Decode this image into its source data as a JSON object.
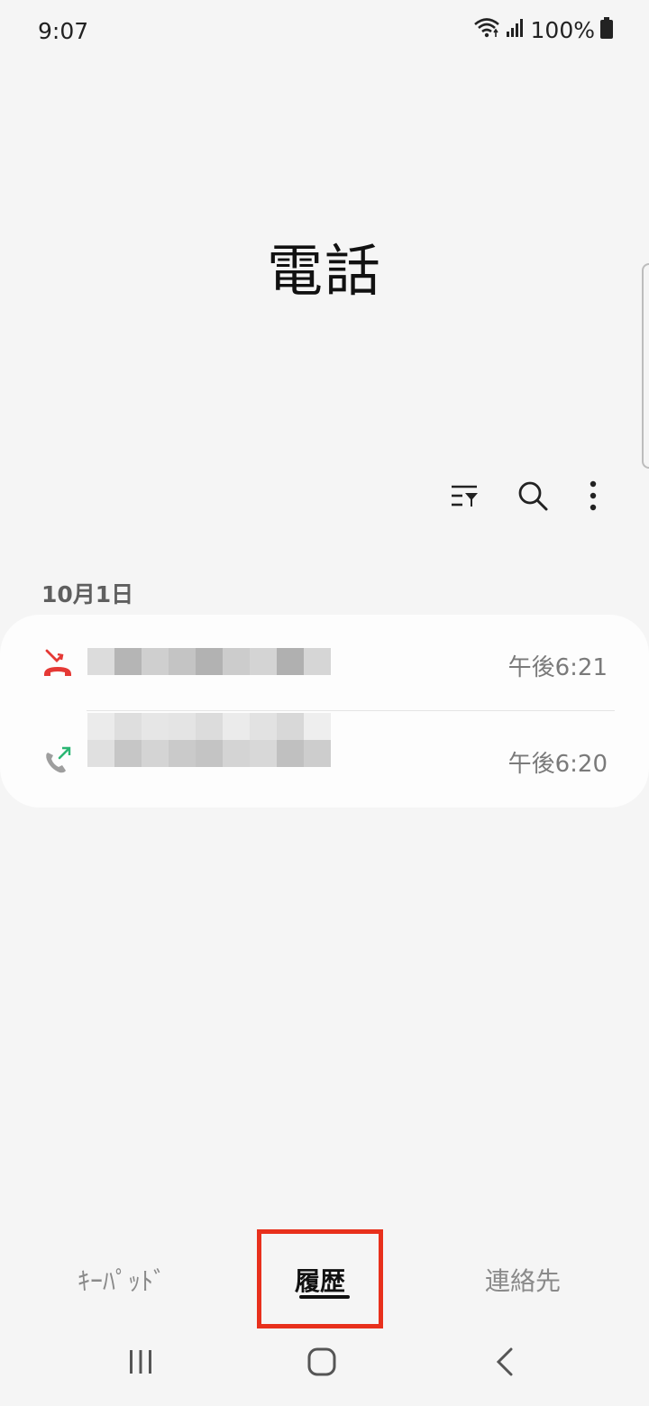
{
  "status_bar": {
    "time": "9:07",
    "battery": "100%",
    "icons": [
      "wifi-icon",
      "signal-icon",
      "battery-icon"
    ]
  },
  "header": {
    "title": "電話"
  },
  "toolbar": {
    "icons": [
      "filter-icon",
      "search-icon",
      "more-options-icon"
    ]
  },
  "call_log": {
    "date_header": "10月1日",
    "entries": [
      {
        "type": "missed",
        "icon": "missed-call-icon",
        "icon_color": "#e53935",
        "name_redacted": true,
        "time": "午後6:21"
      },
      {
        "type": "outgoing",
        "icon": "outgoing-call-icon",
        "icon_color": "#2bb673",
        "name_redacted": true,
        "time": "午後6:20"
      }
    ]
  },
  "bottom_tabs": {
    "keypad": "ｷｰﾊﾟｯﾄﾞ",
    "recents": "履歴",
    "contacts": "連絡先",
    "active": "recents"
  },
  "highlight": {
    "color": "#e8301c",
    "target": "recents"
  },
  "nav_bar": {
    "icons": [
      "recent-apps-icon",
      "home-icon",
      "back-icon"
    ]
  }
}
